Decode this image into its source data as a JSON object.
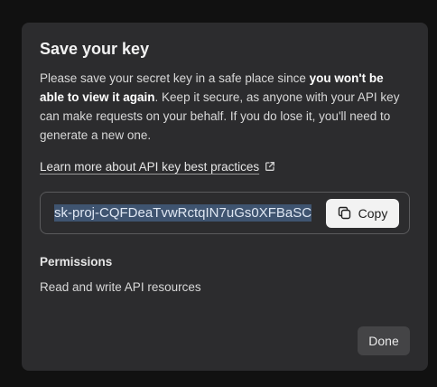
{
  "modal": {
    "title": "Save your key",
    "description_part1": "Please save your secret key in a safe place since ",
    "description_bold": "you won't be able to view it again",
    "description_part2": ". Keep it secure, as anyone with your API key can make requests on your behalf. If you do lose it, you'll need to generate a new one.",
    "learn_more_label": "Learn more about API key best practices",
    "learn_more_icon": "external-link-icon",
    "secret_key_visible": "sk-proj-CQFDeaTvwRctqIN7uGs0XFBaSC",
    "copy_label": "Copy",
    "copy_icon": "copy-icon",
    "permissions_heading": "Permissions",
    "permissions_value": "Read and write API resources",
    "done_label": "Done"
  },
  "colors": {
    "modal_bg": "#2c2c2e",
    "selection_bg": "#3f5470",
    "copy_button_bg": "#f2f2f2",
    "done_button_bg": "#444446"
  }
}
